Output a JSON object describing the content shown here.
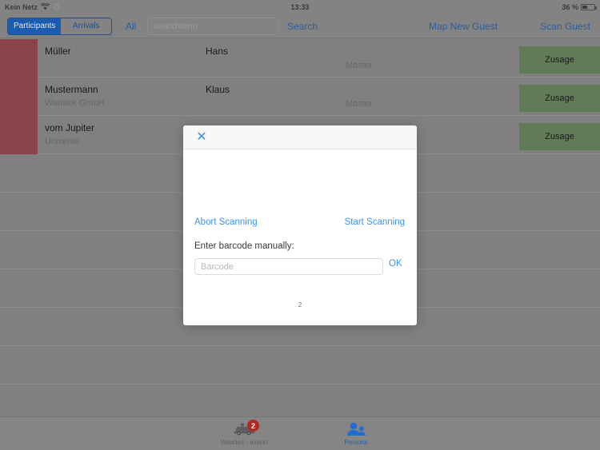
{
  "status_bar": {
    "carrier": "Kein Netz",
    "wifi_icon": "wifi-icon",
    "sync_icon": "sync-icon",
    "time": "13:33",
    "battery_percent": "36 %",
    "battery_icon": "battery-icon"
  },
  "toolbar": {
    "segmented": {
      "selected": "Participants",
      "options": [
        "Participants",
        "Arrivals"
      ]
    },
    "filter_label": "All",
    "search_placeholder": "searchterm",
    "search_value": "",
    "search_button": "Search",
    "map_new_guest": "Map New Guest",
    "scan_guest": "Scan Guest"
  },
  "list": {
    "rows": [
      {
        "last_name": "Müller",
        "company": "",
        "first_name": "Hans",
        "level": "Master",
        "action": "Zusage",
        "flag": true
      },
      {
        "last_name": "Mustermann",
        "company": "Wamtek GmbH",
        "first_name": "Klaus",
        "level": "Master",
        "action": "Zusage",
        "flag": true
      },
      {
        "last_name": "vom Jupiter",
        "company": "Universe",
        "first_name": "",
        "level": "",
        "action": "Zusage",
        "flag": true
      }
    ],
    "empty_row_count": 7
  },
  "modal": {
    "close_icon": "close-icon",
    "abort_scanning": "Abort Scanning",
    "start_scanning": "Start Scanning",
    "barcode_label": "Enter barcode manually:",
    "barcode_placeholder": "Barcode",
    "barcode_value": "",
    "ok_label": "OK",
    "scan_count": "2"
  },
  "tabbar": {
    "tabs": [
      {
        "label": "Vehicles - airport",
        "icon": "car-icon",
        "badge": "2",
        "active": false
      },
      {
        "label": "Persons",
        "icon": "people-icon",
        "badge": "",
        "active": true
      }
    ]
  },
  "colors": {
    "accent_blue": "#2b5fa4",
    "modal_blue": "#3d93e8",
    "flag_red": "#8a4449",
    "action_green": "#617b56",
    "badge_red": "#b02a22"
  }
}
